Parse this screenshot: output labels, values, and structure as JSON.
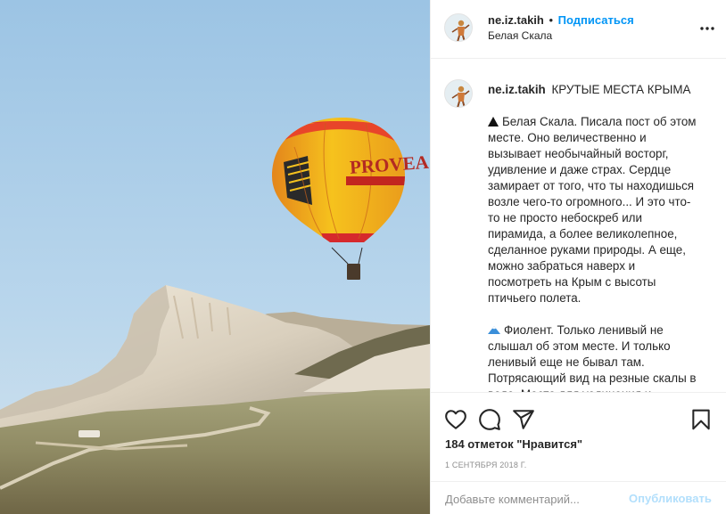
{
  "post": {
    "username": "ne.iz.takih",
    "dot": "•",
    "follow_label": "Подписаться",
    "location": "Белая Скала",
    "more_icon": "more-horizontal-icon",
    "balloon_text": "PROVEA"
  },
  "caption": {
    "username": "ne.iz.takih",
    "title": "КРУТЫЕ МЕСТА КРЫМА",
    "p1_icon": "mountain-icon",
    "p1_text": "Белая Скала. Писала пост об этом месте. Оно величественно и вызывает необычайный восторг, удивление и даже страх. Сердце замирает от того, что ты находишься возле чего-то огромного... И это что-то не просто небоскреб или пирамида, а более великолепное, сделанное руками природы. А еще, можно забраться наверх и посмотреть на Крым с высоты птичьего полета.",
    "p2_icon": "mountain-snow-icon",
    "p2_text": "Фиолент. Только ленивый не слышал об этом месте. И только ленивый еще не бывал там. Потрясающий вид на резные скалы в воде. Место для уединения и"
  },
  "actions": {
    "like_icon": "heart-icon",
    "comment_icon": "comment-icon",
    "share_icon": "share-icon",
    "save_icon": "bookmark-icon",
    "likes_text": "184 отметок \"Нравится\"",
    "date": "1 сентября 2018 г."
  },
  "comment_box": {
    "placeholder": "Добавьте комментарий...",
    "publish_label": "Опубликовать"
  },
  "colors": {
    "accent": "#0095f6",
    "publish_disabled": "#b2dffc",
    "border": "#efefef",
    "secondary_text": "#8e8e8e"
  }
}
